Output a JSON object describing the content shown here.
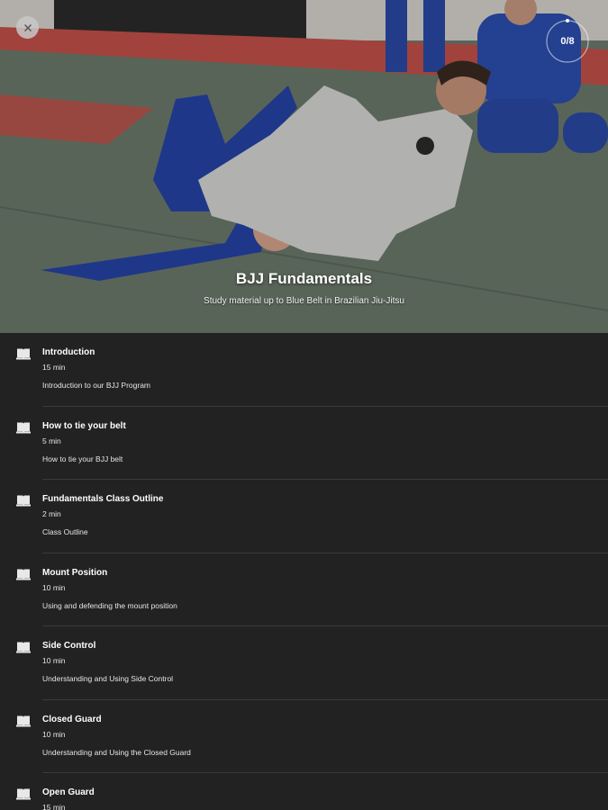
{
  "header": {
    "title": "BJJ Fundamentals",
    "subtitle": "Study material up to Blue Belt in Brazilian Jiu-Jitsu",
    "progress": "0/8",
    "close_icon": "close-icon"
  },
  "lessons": [
    {
      "title": "Introduction",
      "duration": "15 min",
      "description": "Introduction to our BJJ Program",
      "icon": "book-icon"
    },
    {
      "title": "How to tie your belt",
      "duration": "5 min",
      "description": "How to tie your BJJ belt",
      "icon": "book-icon"
    },
    {
      "title": "Fundamentals Class Outline",
      "duration": "2 min",
      "description": "Class Outline",
      "icon": "book-icon"
    },
    {
      "title": "Mount Position",
      "duration": "10 min",
      "description": "Using and defending the mount position",
      "icon": "book-icon"
    },
    {
      "title": "Side Control",
      "duration": "10 min",
      "description": "Understanding and Using Side Control",
      "icon": "book-icon"
    },
    {
      "title": "Closed Guard",
      "duration": "10 min",
      "description": "Understanding and Using the Closed Guard",
      "icon": "book-icon"
    },
    {
      "title": "Open Guard",
      "duration": "15 min",
      "description": "",
      "icon": "book-icon"
    }
  ]
}
